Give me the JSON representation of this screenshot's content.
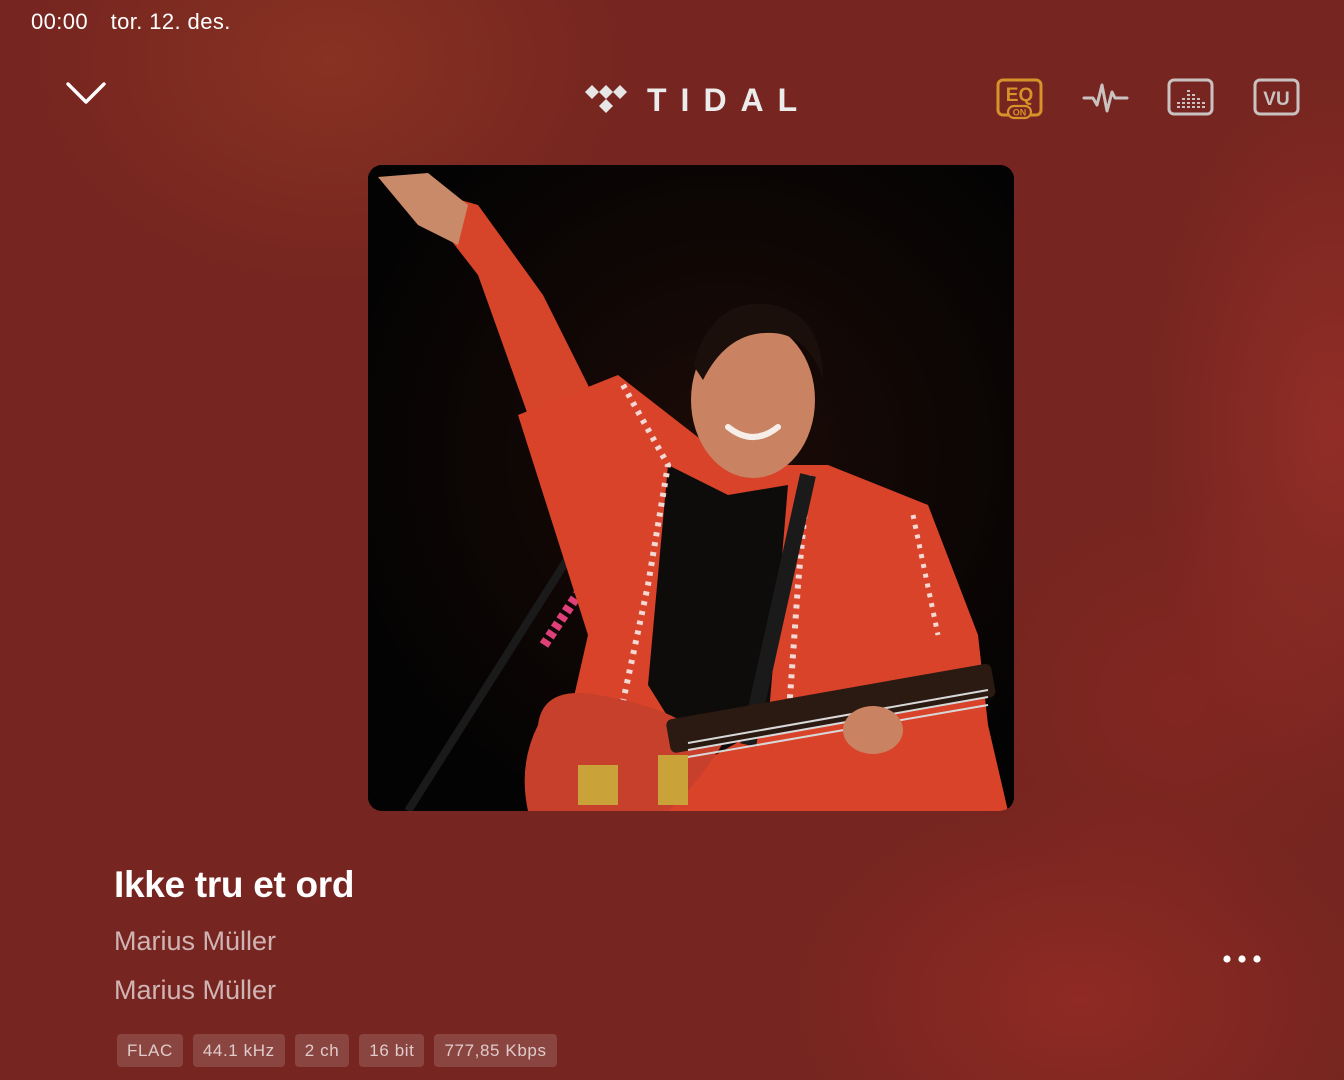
{
  "status_bar": {
    "time": "00:00",
    "date": "tor. 12. des."
  },
  "header": {
    "logo_text": "TIDAL",
    "eq_label": "EQ",
    "eq_state": "ON",
    "vu_label": "VU",
    "icons": [
      "chevron-down-icon",
      "tidal-logo-icon",
      "eq-icon",
      "waveform-icon",
      "spectrum-icon",
      "vu-meter-icon"
    ]
  },
  "track": {
    "title": "Ikke tru et ord",
    "artist": "Marius Müller",
    "album": "Marius Müller"
  },
  "format_badges": [
    "FLAC",
    "44.1 kHz",
    "2 ch",
    "16 bit",
    "777,85 Kbps"
  ],
  "colors": {
    "background": "#762520",
    "eq_accent": "#d8922a",
    "icon_gray": "#c9c2c0"
  }
}
